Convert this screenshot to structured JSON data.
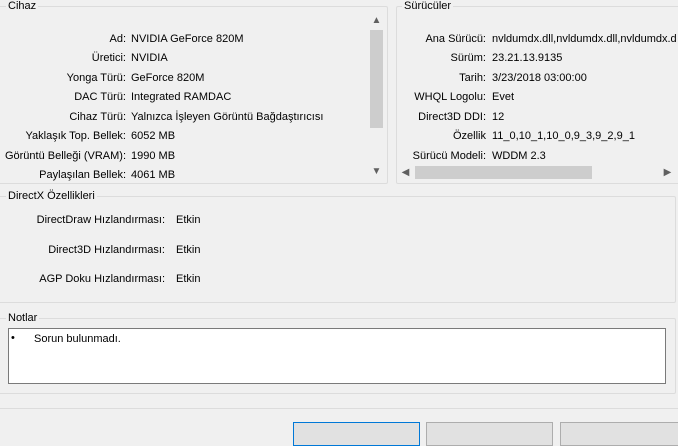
{
  "device": {
    "title": "Cihaz",
    "rows": [
      {
        "label": "Ad:",
        "value": "NVIDIA GeForce 820M"
      },
      {
        "label": "Üretici:",
        "value": "NVIDIA"
      },
      {
        "label": "Yonga Türü:",
        "value": "GeForce 820M"
      },
      {
        "label": "DAC Türü:",
        "value": "Integrated RAMDAC"
      },
      {
        "label": "Cihaz Türü:",
        "value": "Yalnızca İşleyen Görüntü Bağdaştırıcısı"
      },
      {
        "label": "Yaklaşık Top. Bellek:",
        "value": "6052 MB"
      },
      {
        "label": "Görüntü Belleği (VRAM):",
        "value": "1990 MB"
      },
      {
        "label": "Paylaşılan Bellek:",
        "value": "4061 MB"
      }
    ]
  },
  "drivers": {
    "title": "Sürücüler",
    "rows": [
      {
        "label": "Ana Sürücü:",
        "value": "nvldumdx.dll,nvldumdx.dll,nvldumdx.d"
      },
      {
        "label": "Sürüm:",
        "value": "23.21.13.9135"
      },
      {
        "label": "Tarih:",
        "value": "3/23/2018 03:00:00"
      },
      {
        "label": "WHQL Logolu:",
        "value": "Evet"
      },
      {
        "label": "Direct3D DDI:",
        "value": "12"
      },
      {
        "label": "Özellik",
        "value": "11_0,10_1,10_0,9_3,9_2,9_1"
      },
      {
        "label": "Sürücü Modeli:",
        "value": "WDDM 2.3"
      }
    ]
  },
  "directx": {
    "title": "DirectX Özellikleri",
    "rows": [
      {
        "label": "DirectDraw Hızlandırması:",
        "value": "Etkin"
      },
      {
        "label": "Direct3D Hızlandırması:",
        "value": "Etkin"
      },
      {
        "label": "AGP Doku Hızlandırması:",
        "value": "Etkin"
      }
    ]
  },
  "notes": {
    "title": "Notlar",
    "bullet": "•",
    "items": [
      "Sorun bulunmadı."
    ]
  },
  "colors": {
    "window_bg": "#f0f0f0",
    "group_border": "#dcdcdc",
    "scroll_thumb": "#cdcdcd",
    "primary_button_border": "#0078d7"
  },
  "icons": {
    "scroll_up": "▲",
    "scroll_down": "▼",
    "scroll_left": "◀",
    "scroll_right": "▶"
  }
}
